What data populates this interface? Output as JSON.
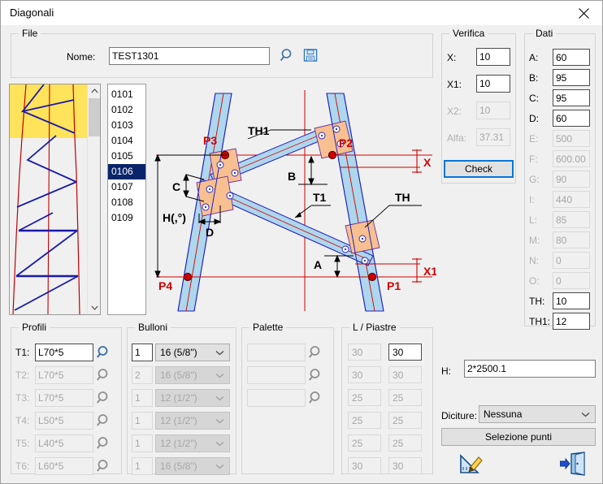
{
  "window": {
    "title": "Diagonali",
    "close_icon": "close-icon"
  },
  "file_group": {
    "legend": "File",
    "nome_label": "Nome:",
    "nome_value": "TEST1301",
    "search_icon": "magnifier-icon",
    "save_icon": "floppy-save-icon"
  },
  "preview": {
    "scroll_up_icon": "chevron-up-icon",
    "scroll_down_icon": "chevron-down-icon"
  },
  "list": {
    "items": [
      "0101",
      "0102",
      "0103",
      "0104",
      "0105",
      "0106",
      "0107",
      "0108",
      "0109"
    ],
    "selected_index": 5
  },
  "drawing": {
    "labels": {
      "p1": "P1",
      "p2": "P2",
      "p3": "P3",
      "p4": "P4",
      "x": "X",
      "x1": "X1",
      "a": "A",
      "b": "B",
      "c": "C",
      "d": "D",
      "h": "H(,°)",
      "t1": "T1",
      "th": "TH",
      "th1": "TH1"
    }
  },
  "verifica": {
    "legend": "Verifica",
    "rows": [
      {
        "label": "X:",
        "value": "10",
        "enabled": true
      },
      {
        "label": "X1:",
        "value": "10",
        "enabled": true
      },
      {
        "label": "X2:",
        "value": "10",
        "enabled": false
      },
      {
        "label": "Alfa:",
        "value": "37.31",
        "enabled": false
      }
    ],
    "check_label": "Check"
  },
  "dati": {
    "legend": "Dati",
    "rows": [
      {
        "label": "A:",
        "value": "60",
        "enabled": true
      },
      {
        "label": "B:",
        "value": "95",
        "enabled": true
      },
      {
        "label": "C:",
        "value": "95",
        "enabled": true
      },
      {
        "label": "D:",
        "value": "60",
        "enabled": true
      },
      {
        "label": "E:",
        "value": "500",
        "enabled": false
      },
      {
        "label": "F:",
        "value": "600.00",
        "enabled": false
      },
      {
        "label": "G:",
        "value": "90",
        "enabled": false
      },
      {
        "label": "I:",
        "value": "440",
        "enabled": false
      },
      {
        "label": "L:",
        "value": "85",
        "enabled": false
      },
      {
        "label": "M:",
        "value": "80",
        "enabled": false
      },
      {
        "label": "N:",
        "value": "0",
        "enabled": false
      },
      {
        "label": "O:",
        "value": "0",
        "enabled": false
      },
      {
        "label": "TH:",
        "value": "10",
        "enabled": true
      },
      {
        "label": "TH1:",
        "value": "12",
        "enabled": true
      }
    ]
  },
  "profili": {
    "legend": "Profili",
    "rows": [
      {
        "label": "T1:",
        "value": "L70*5",
        "enabled": true
      },
      {
        "label": "T2:",
        "value": "L70*5",
        "enabled": false
      },
      {
        "label": "T3:",
        "value": "L70*5",
        "enabled": false
      },
      {
        "label": "T4:",
        "value": "L50*5",
        "enabled": false
      },
      {
        "label": "T5:",
        "value": "L40*5",
        "enabled": false
      },
      {
        "label": "T6:",
        "value": "L60*5",
        "enabled": false
      }
    ],
    "search_icon": "magnifier-icon"
  },
  "bulloni": {
    "legend": "Bulloni",
    "rows": [
      {
        "count": "1",
        "size": "16 (5/8\")",
        "enabled": true
      },
      {
        "count": "2",
        "size": "16 (5/8\")",
        "enabled": false
      },
      {
        "count": "1",
        "size": "12 (1/2\")",
        "enabled": false
      },
      {
        "count": "1",
        "size": "12 (1/2\")",
        "enabled": false
      },
      {
        "count": "1",
        "size": "12 (1/2\")",
        "enabled": false
      },
      {
        "count": "1",
        "size": "16 (5/8\")",
        "enabled": false
      }
    ],
    "dropdown_icon": "chevron-down-icon"
  },
  "palette": {
    "legend": "Palette",
    "rows": [
      {
        "value": "",
        "enabled": false
      },
      {
        "value": "",
        "enabled": false
      },
      {
        "value": "",
        "enabled": false
      }
    ],
    "search_icon": "magnifier-icon"
  },
  "piastre": {
    "legend": "L / Piastre",
    "rows": [
      {
        "left": "30",
        "right": "30",
        "right_active": true
      },
      {
        "left": "30",
        "right": "30",
        "right_active": false
      },
      {
        "left": "25",
        "right": "25",
        "right_active": false
      },
      {
        "left": "25",
        "right": "25",
        "right_active": false
      },
      {
        "left": "25",
        "right": "25",
        "right_active": false
      },
      {
        "left": "30",
        "right": "30",
        "right_active": false
      }
    ]
  },
  "bottom_right": {
    "h_label": "H:",
    "h_value": "2*2500.1",
    "diciture_label": "Diciture:",
    "diciture_value": "Nessuna",
    "diciture_icon": "chevron-down-icon",
    "selezione_punti_label": "Selezione punti",
    "draw_icon": "ruler-pencil-icon",
    "exit_icon": "exit-door-icon"
  },
  "colors": {
    "accent": "#0078d7",
    "selection": "#09246b",
    "highlight": "#ffe35b",
    "steel_blue": "#aed6ec",
    "outline_blue": "#2020c0",
    "plate_orange": "#f8c090",
    "red": "#d00000"
  }
}
